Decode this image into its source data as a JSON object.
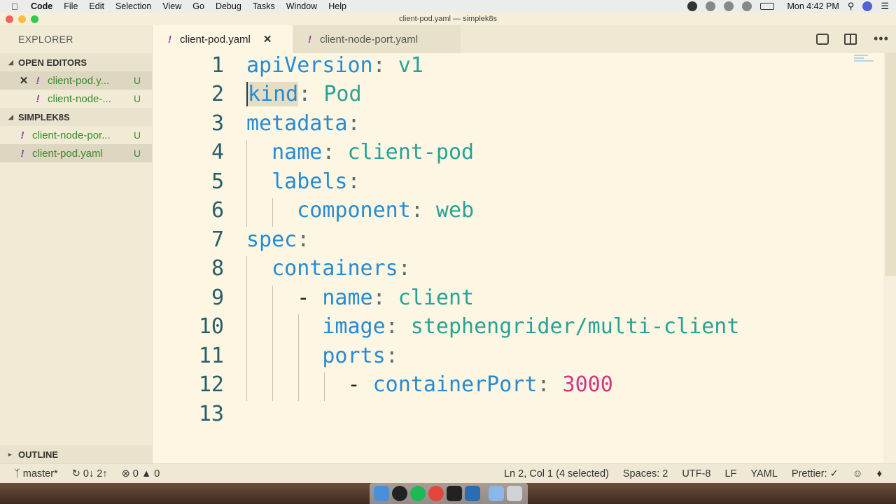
{
  "menubar": {
    "app": "Code",
    "items": [
      "File",
      "Edit",
      "Selection",
      "View",
      "Go",
      "Debug",
      "Tasks",
      "Window",
      "Help"
    ],
    "clock": "Mon 4:42 PM"
  },
  "window": {
    "title": "client-pod.yaml — simplek8s"
  },
  "sidebar": {
    "title": "EXPLORER",
    "open_editors_label": "OPEN EDITORS",
    "open_editors": [
      {
        "name": "client-pod.y...",
        "status": "U"
      },
      {
        "name": "client-node-...",
        "status": "U"
      }
    ],
    "project_label": "SIMPLEK8S",
    "files": [
      {
        "name": "client-node-por...",
        "status": "U"
      },
      {
        "name": "client-pod.yaml",
        "status": "U"
      }
    ],
    "outline_label": "OUTLINE"
  },
  "tabs": [
    {
      "label": "client-pod.yaml",
      "active": true
    },
    {
      "label": "client-node-port.yaml",
      "active": false
    }
  ],
  "editor": {
    "line_numbers": [
      "1",
      "2",
      "3",
      "4",
      "5",
      "6",
      "7",
      "8",
      "9",
      "10",
      "11",
      "12",
      "13"
    ],
    "tokens": {
      "l1_key": "apiVersion",
      "l1_colon": ":",
      "l1_val": " v1",
      "l2_key": "kind",
      "l2_colon": ":",
      "l2_val": " Pod",
      "l3_key": "metadata",
      "l3_colon": ":",
      "l4_key": "name",
      "l4_colon": ":",
      "l4_val": " client-pod",
      "l5_key": "labels",
      "l5_colon": ":",
      "l6_key": "component",
      "l6_colon": ":",
      "l6_val": " web",
      "l7_key": "spec",
      "l7_colon": ":",
      "l8_key": "containers",
      "l8_colon": ":",
      "l9_dash": "- ",
      "l9_key": "name",
      "l9_colon": ":",
      "l9_val": " client",
      "l10_key": "image",
      "l10_colon": ":",
      "l10_val": " stephengrider/multi-client",
      "l11_key": "ports",
      "l11_colon": ":",
      "l12_dash": "- ",
      "l12_key": "containerPort",
      "l12_colon": ":",
      "l12_val": " 3000"
    }
  },
  "statusbar": {
    "branch": "master*",
    "sync": "0↓ 2↑",
    "errors": "0",
    "warnings": "0",
    "position": "Ln 2, Col 1 (4 selected)",
    "spaces": "Spaces: 2",
    "encoding": "UTF-8",
    "eol": "LF",
    "language": "YAML",
    "formatter": "Prettier: ✓"
  },
  "colors": {
    "key": "#268bd2",
    "value": "#2aa198",
    "number": "#d33682",
    "background": "#fdf6e3",
    "untracked": "#3a8a2a"
  }
}
